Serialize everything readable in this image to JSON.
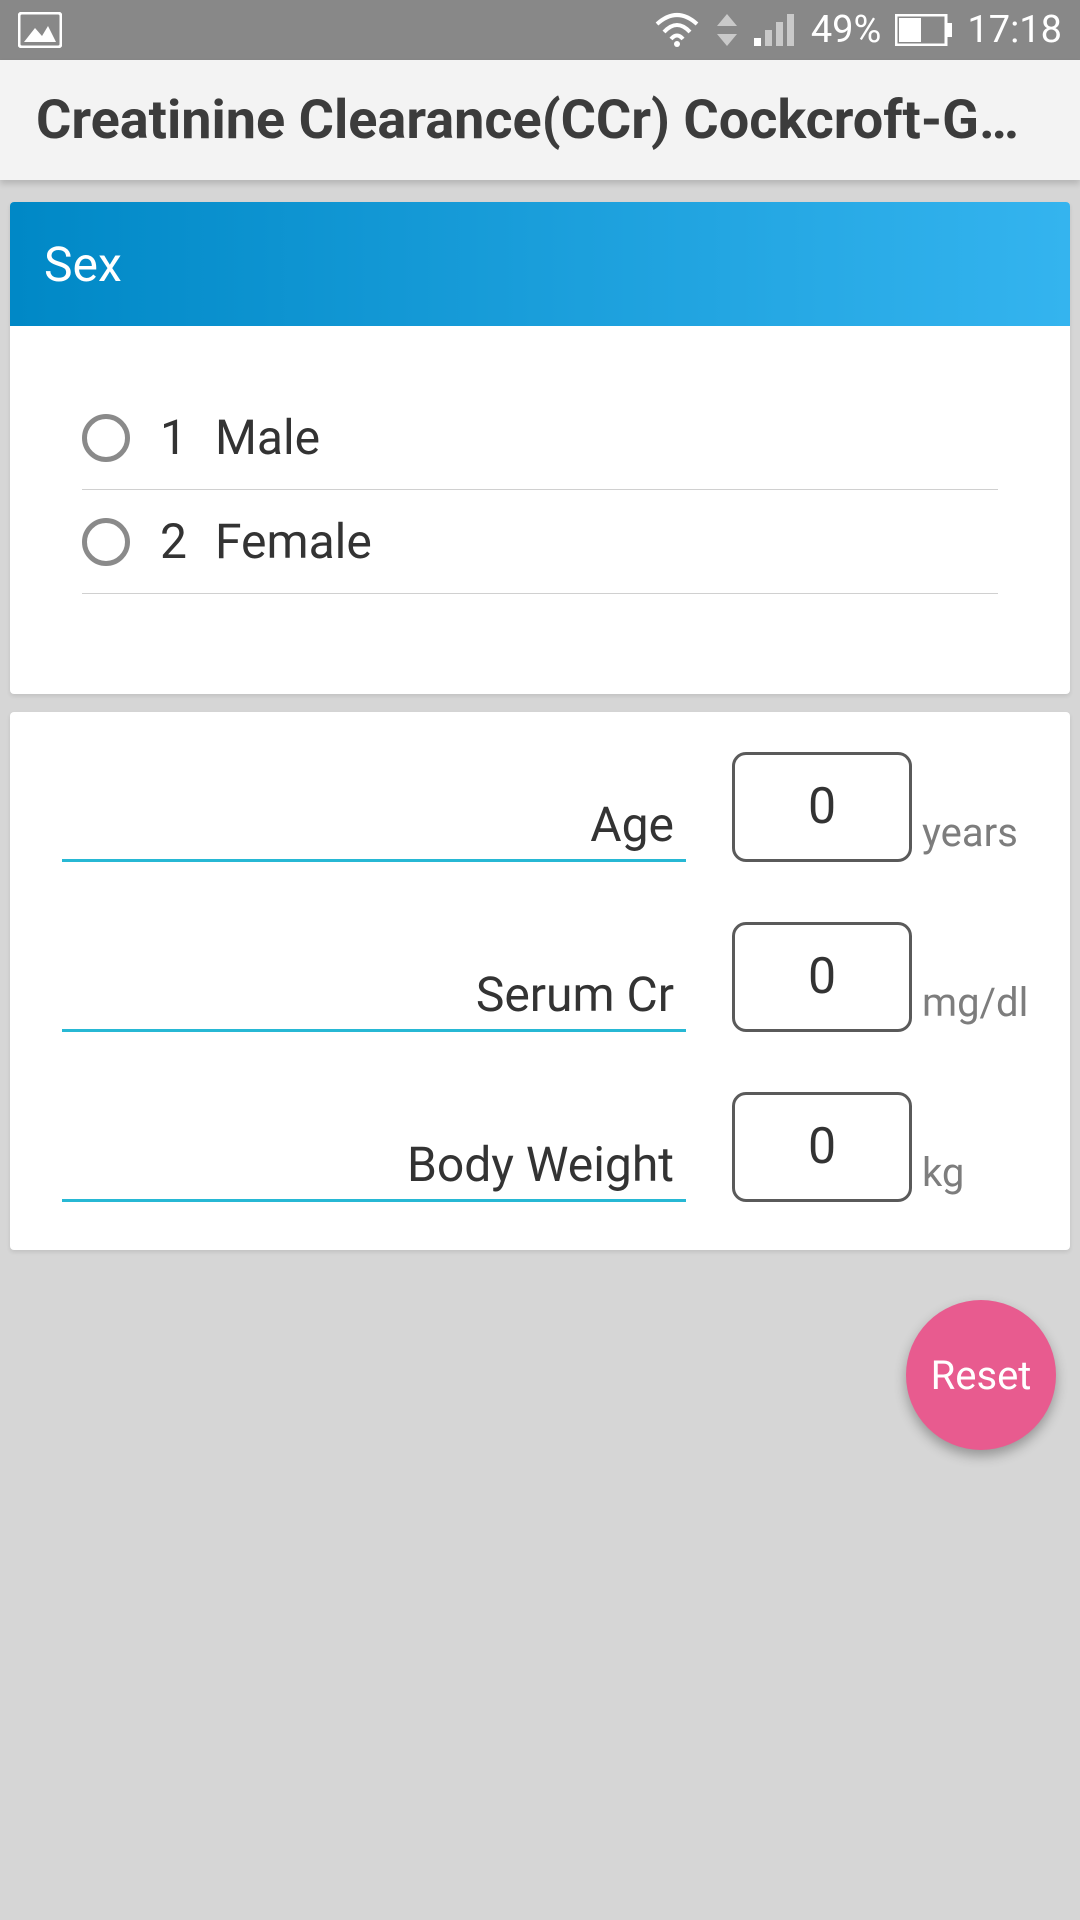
{
  "status_bar": {
    "battery_percent": "49%",
    "time": "17:18"
  },
  "app_bar": {
    "title": "Creatinine Clearance(CCr) Cockcroft-Gault"
  },
  "sex_section": {
    "header": "Sex",
    "options": [
      {
        "num": "1",
        "label": "Male"
      },
      {
        "num": "2",
        "label": "Female"
      }
    ]
  },
  "inputs": [
    {
      "label": "Age",
      "value": "0",
      "unit": "years"
    },
    {
      "label": "Serum Cr",
      "value": "0",
      "unit": "mg/dl"
    },
    {
      "label": "Body Weight",
      "value": "0",
      "unit": "kg"
    }
  ],
  "fab": {
    "label": "Reset"
  }
}
